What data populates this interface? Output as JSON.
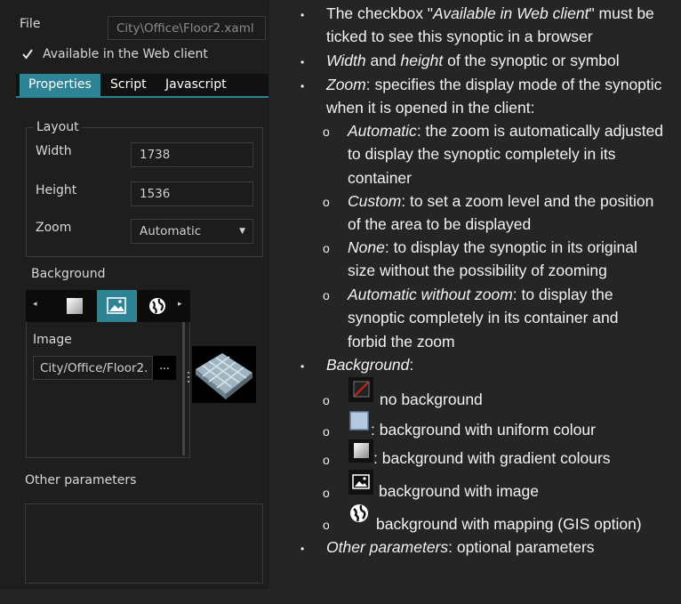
{
  "panel": {
    "file_label": "File",
    "file_value": "City\\Office\\Floor2.xaml",
    "web_checkbox_label": "Available in the Web client",
    "tabs": [
      "Properties",
      "Script",
      "Javascript"
    ],
    "layout_title": "Layout",
    "width_label": "Width",
    "width_value": "1738",
    "height_label": "Height",
    "height_value": "1536",
    "zoom_label": "Zoom",
    "zoom_value": "Automatic",
    "background_label": "Background",
    "image_label": "Image",
    "image_value": "City/Office/Floor2.",
    "browse_label": "...",
    "other_label": "Other parameters"
  },
  "doc": {
    "b1_l1_a": "The checkbox \"",
    "b1_l1_i": "Available in Web client",
    "b1_l1_b": "\" must be",
    "b1_l2": "ticked to see this synoptic in a browser",
    "b2_i1": "Width",
    "b2_t1": " and ",
    "b2_i2": "height",
    "b2_t2": " of the synoptic or symbol",
    "b3_i": "Zoom",
    "b3_l1": ": specifies the display mode of the synoptic",
    "b3_l2": "when it is opened in the client:",
    "s1_i": "Automatic",
    "s1_l1": ": the zoom is automatically adjusted",
    "s1_l2": "to display the synoptic completely in its",
    "s1_l3": "container",
    "s2_i": "Custom",
    "s2_l1": ": to set a zoom level and the position",
    "s2_l2": "of the area to be displayed",
    "s3_i": "None",
    "s3_l1": ": to display the synoptic in its original",
    "s3_l2": "size without the possibility of zooming",
    "s4_i": "Automatic without zoom",
    "s4_l1": ": to display the",
    "s4_l2": "synoptic completely in its container and",
    "s4_l3": "forbid the zoom",
    "b4_i": "Background",
    "b4_t": ":",
    "bg1": "no background",
    "bg2": ": background with uniform colour",
    "bg3": ": background with gradient colours",
    "bg4": "background with image",
    "bg5": "background with mapping (GIS option)",
    "b5_i": "Other parameters",
    "b5_t": ": optional parameters",
    "bullet": "•",
    "sub_bullet": "o"
  },
  "colors": {
    "accent": "#2e8394",
    "panel_bg": "#1e1e1e",
    "page_bg": "#252526"
  }
}
